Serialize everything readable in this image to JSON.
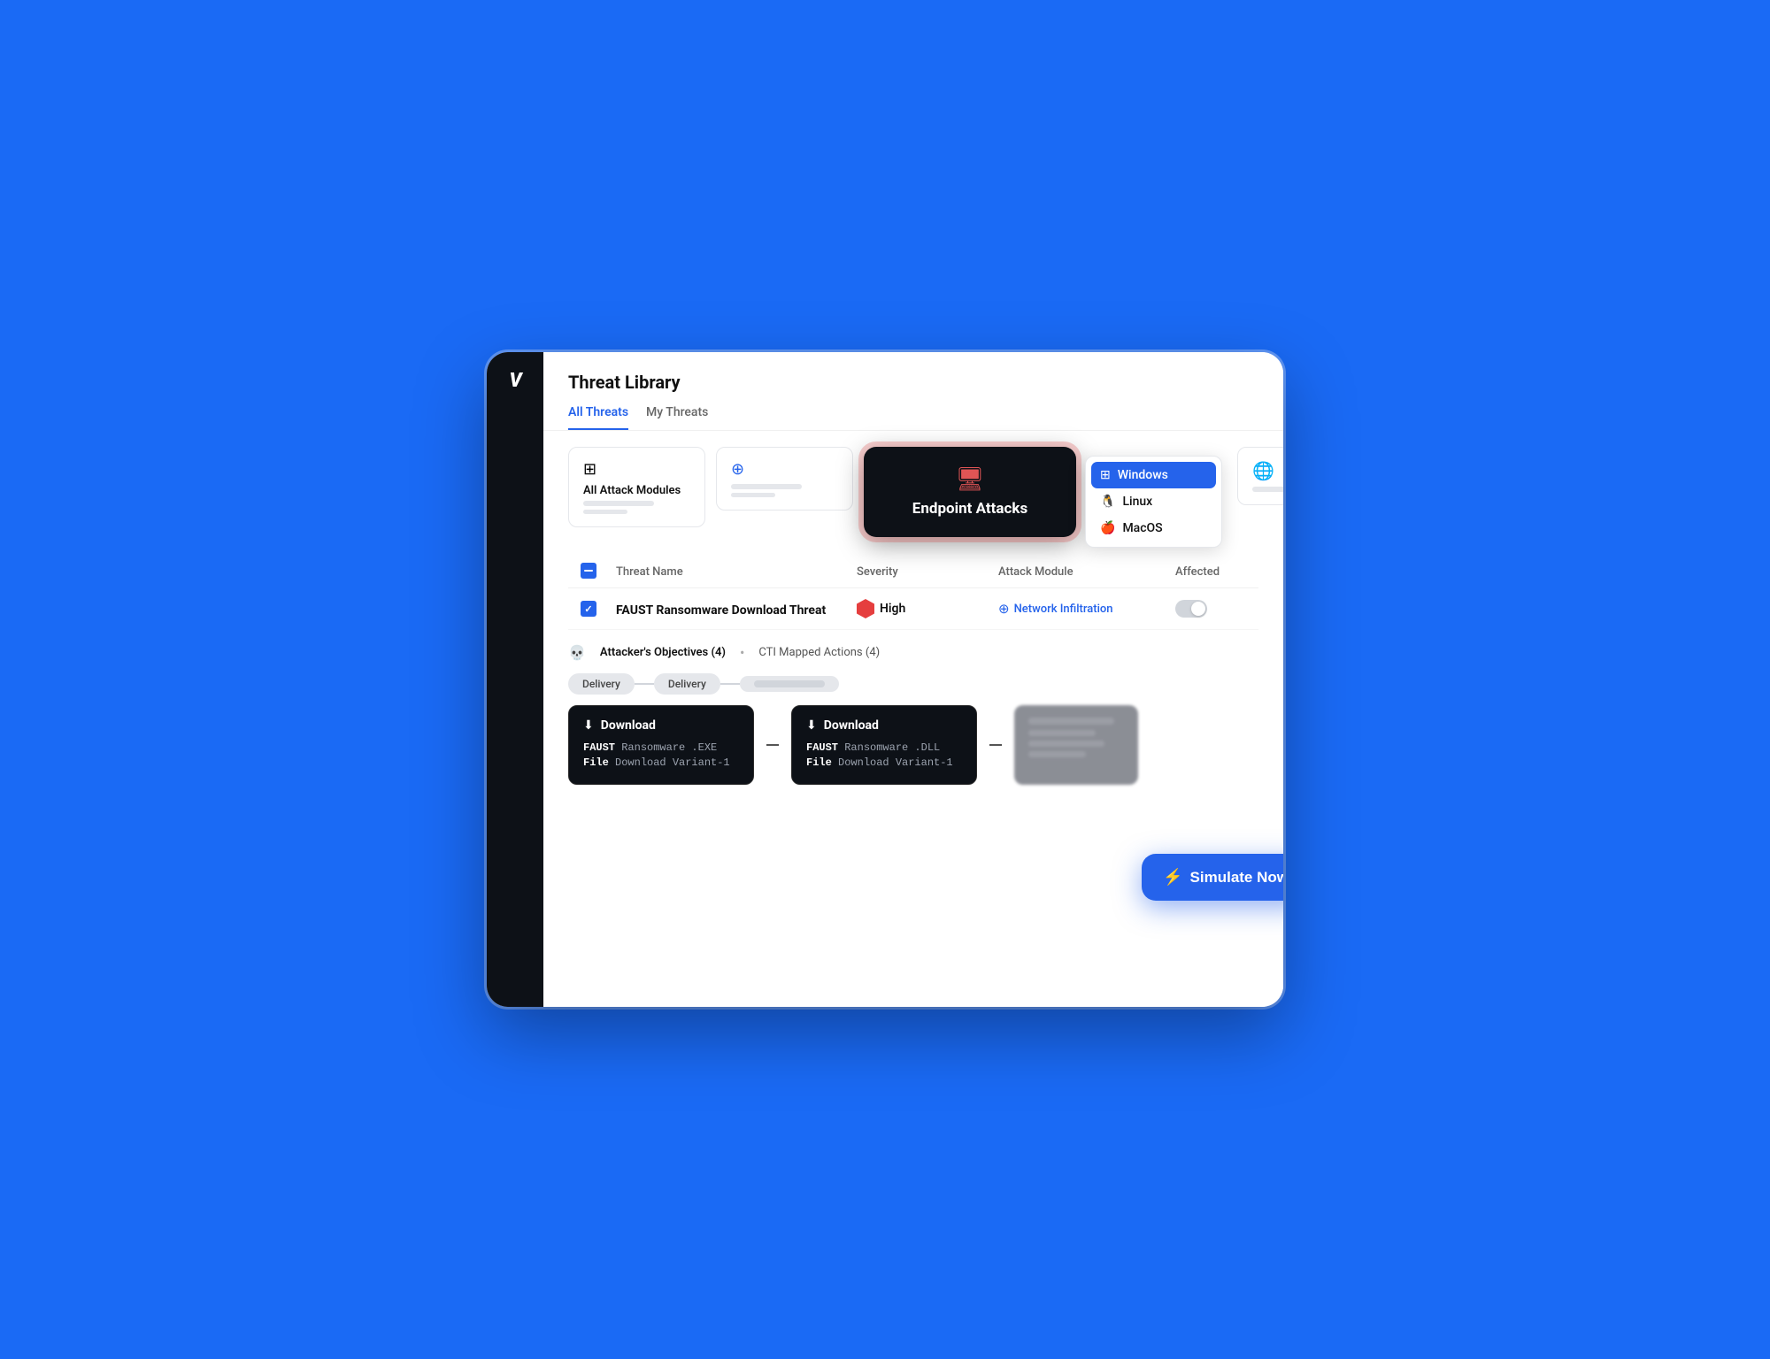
{
  "app": {
    "logo": "V",
    "title": "Threat Library"
  },
  "tabs": [
    {
      "id": "all-threats",
      "label": "All Threats",
      "active": true
    },
    {
      "id": "my-threats",
      "label": "My Threats",
      "active": false
    }
  ],
  "filter_cards": [
    {
      "id": "all-attack-modules",
      "icon": "⊞",
      "label": "All Attack Modules",
      "active": false
    },
    {
      "id": "download-module",
      "icon": "⊕",
      "label": "",
      "active": false
    },
    {
      "id": "endpoint-attacks",
      "icon": "🖥",
      "label": "Endpoint Attacks",
      "active": true
    }
  ],
  "os_options": [
    {
      "id": "windows",
      "label": "Windows",
      "selected": true,
      "icon": "⊞"
    },
    {
      "id": "linux",
      "label": "Linux",
      "selected": false,
      "icon": "🐧"
    },
    {
      "id": "macos",
      "label": "MacOS",
      "selected": false,
      "icon": "🍎"
    }
  ],
  "globe_card": {
    "icon": "🌐"
  },
  "table": {
    "columns": [
      "Threat Name",
      "Severity",
      "Attack Module",
      "Affected"
    ],
    "rows": [
      {
        "id": "faust-ransomware",
        "name": "FAUST Ransomware Download Threat",
        "severity": "High",
        "severity_color": "#e53e3e",
        "module": "Network Infiltration",
        "checked": true
      }
    ]
  },
  "threat_details": {
    "objectives_count": 4,
    "cti_count": 4,
    "objectives_label": "Attacker's Objectives (4)",
    "cti_label": "CTI Mapped Actions (4)"
  },
  "delivery_stages": [
    "Delivery",
    "Delivery",
    ""
  ],
  "download_cards": [
    {
      "title": "Download",
      "lines": [
        {
          "keyword": "FAUST",
          "value": " Ransomware .EXE"
        },
        {
          "keyword": "File",
          "value": " Download Variant-1"
        }
      ]
    },
    {
      "title": "Download",
      "lines": [
        {
          "keyword": "FAUST",
          "value": " Ransomware .DLL"
        },
        {
          "keyword": "File",
          "value": " Download Variant-1"
        }
      ]
    }
  ],
  "simulate_btn": {
    "label": "Simulate Now",
    "icon": "⚡"
  }
}
